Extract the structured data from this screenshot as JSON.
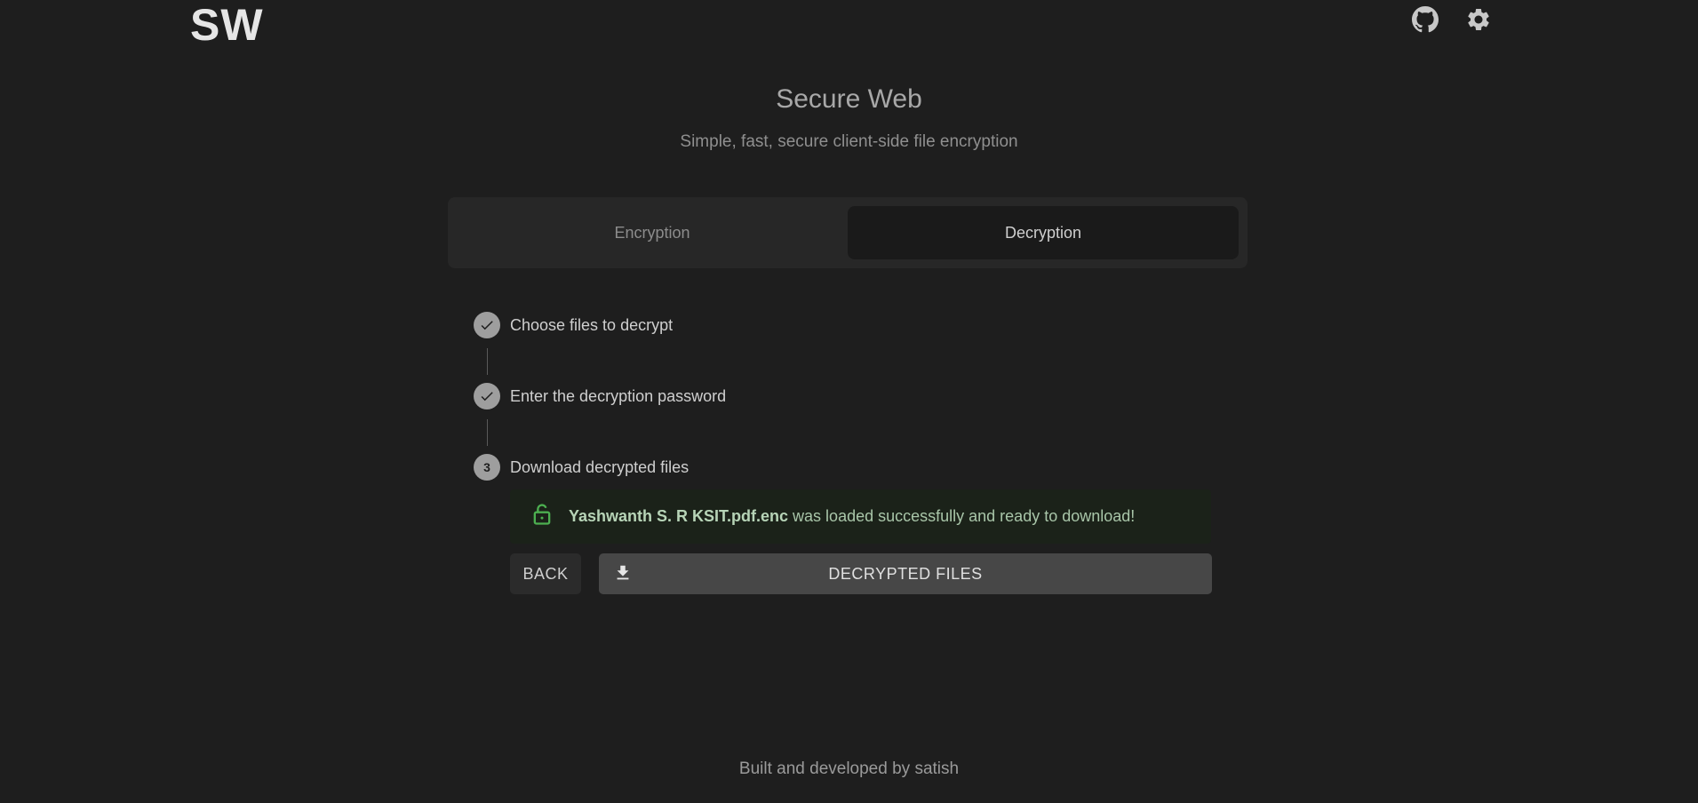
{
  "header": {
    "logo": "SW",
    "icons": [
      "github-icon",
      "gear-icon"
    ]
  },
  "hero": {
    "title": "Secure Web",
    "subtitle": "Simple, fast, secure client-side file encryption"
  },
  "tabs": [
    {
      "label": "Encryption",
      "active": false
    },
    {
      "label": "Decryption",
      "active": true
    }
  ],
  "steps": [
    {
      "label": "Choose files to decrypt",
      "status": "complete"
    },
    {
      "label": "Enter the decryption password",
      "status": "complete"
    },
    {
      "number": "3",
      "label": "Download decrypted files",
      "status": "active"
    }
  ],
  "alert": {
    "filename": "Yashwanth S. R KSIT.pdf.enc",
    "message": " was loaded successfully and ready to download!",
    "icon": "lock-open-icon",
    "color": "#4caf50"
  },
  "actions": {
    "back_label": "BACK",
    "download_label": "DECRYPTED FILES"
  },
  "footer": {
    "text": "Built and developed by satish"
  },
  "colors": {
    "background": "#1e1e1e",
    "tab_active_bg": "#1a1a1a",
    "download_button_bg": "#474747"
  }
}
